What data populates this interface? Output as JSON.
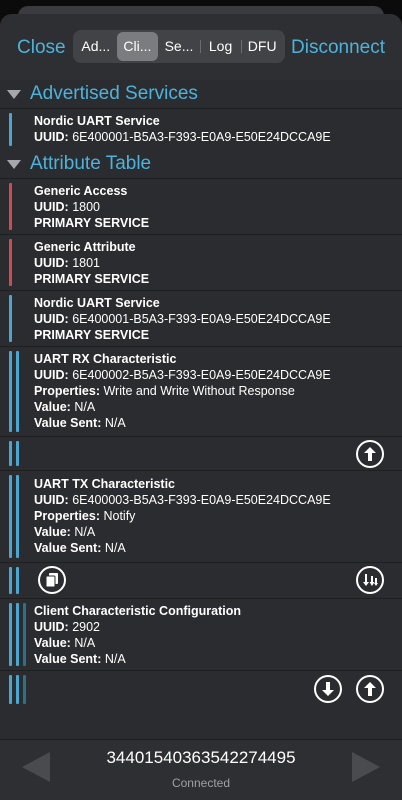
{
  "header": {
    "close_label": "Close",
    "disconnect_label": "Disconnect",
    "tabs": [
      {
        "label": "Ad...",
        "selected": false
      },
      {
        "label": "Cli...",
        "selected": true
      },
      {
        "label": "Se...",
        "selected": false
      },
      {
        "label": "Log",
        "selected": false
      },
      {
        "label": "DFU",
        "selected": false
      }
    ]
  },
  "advertised": {
    "section_title": "Advertised Services",
    "service": {
      "name": "Nordic UART Service",
      "uuid_label": "UUID:",
      "uuid": "6E400001-B5A3-F393-E0A9-E50E24DCCA9E"
    }
  },
  "attribute_table": {
    "section_title": "Attribute Table",
    "generic_access": {
      "name": "Generic Access",
      "uuid_label": "UUID:",
      "uuid": "1800",
      "type": "PRIMARY SERVICE"
    },
    "generic_attribute": {
      "name": "Generic Attribute",
      "uuid_label": "UUID:",
      "uuid": "1801",
      "type": "PRIMARY SERVICE"
    },
    "nordic_uart": {
      "name": "Nordic UART Service",
      "uuid_label": "UUID:",
      "uuid": "6E400001-B5A3-F393-E0A9-E50E24DCCA9E",
      "type": "PRIMARY SERVICE"
    },
    "rx": {
      "name": "UART RX Characteristic",
      "uuid_label": "UUID:",
      "uuid": "6E400002-B5A3-F393-E0A9-E50E24DCCA9E",
      "properties_label": "Properties:",
      "properties": "Write and Write Without Response",
      "value_label": "Value:",
      "value": "N/A",
      "value_sent_label": "Value Sent:",
      "value_sent": "N/A"
    },
    "tx": {
      "name": "UART TX Characteristic",
      "uuid_label": "UUID:",
      "uuid": "6E400003-B5A3-F393-E0A9-E50E24DCCA9E",
      "properties_label": "Properties:",
      "properties": "Notify",
      "value_label": "Value:",
      "value": "N/A",
      "value_sent_label": "Value Sent:",
      "value_sent": "N/A"
    },
    "cccd": {
      "name": "Client Characteristic Configuration",
      "uuid_label": "UUID:",
      "uuid": "2902",
      "value_label": "Value:",
      "value": "N/A",
      "value_sent_label": "Value Sent:",
      "value_sent": "N/A"
    }
  },
  "footer": {
    "counter": "34401540363542274495",
    "status": "Connected"
  },
  "colors": {
    "accent": "#4db3dc",
    "service_bar": "#4aa7cf",
    "generic_bar": "#d04a56"
  }
}
